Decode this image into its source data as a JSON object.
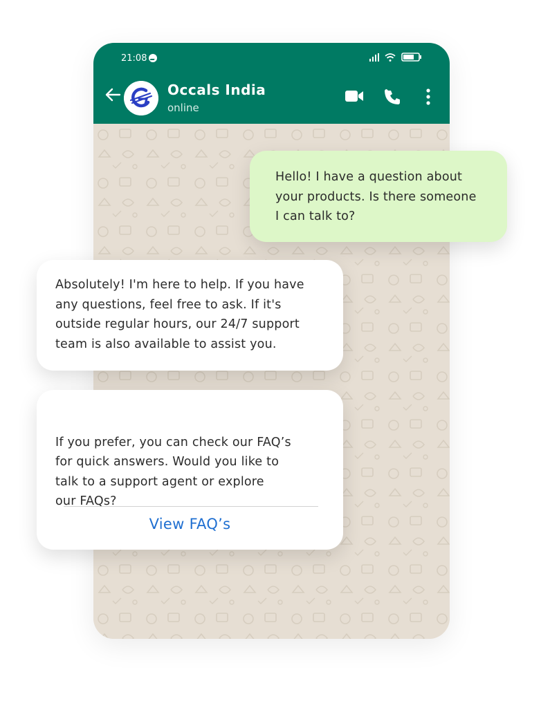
{
  "status_bar": {
    "time": "21:08"
  },
  "header": {
    "contact_name": "Occals India",
    "contact_status": "online",
    "back_icon": "arrow-left-icon",
    "video_icon": "video-camera-icon",
    "call_icon": "phone-icon",
    "menu_icon": "more-vertical-icon"
  },
  "messages": [
    {
      "direction": "outgoing",
      "text": "Hello! I have a question about\nyour products. Is there someone\nI can talk to?"
    },
    {
      "direction": "incoming",
      "text": "Absolutely! I'm here to help. If you have\nany questions, feel free to ask. If it's\noutside regular hours, our 24/7 support\nteam is also available to assist you."
    },
    {
      "direction": "incoming",
      "text": "If you prefer, you can check our FAQ’s\nfor quick answers. Would you like to\ntalk to a support agent or explore\nour FAQs?",
      "action_label": "View FAQ’s"
    }
  ],
  "colors": {
    "header_bg": "#007a63",
    "chat_bg": "#e6ded3",
    "outgoing_bubble": "#ddf7c8",
    "incoming_bubble": "#ffffff",
    "link": "#1f6fd1",
    "logo_blue": "#2b3fc4"
  }
}
